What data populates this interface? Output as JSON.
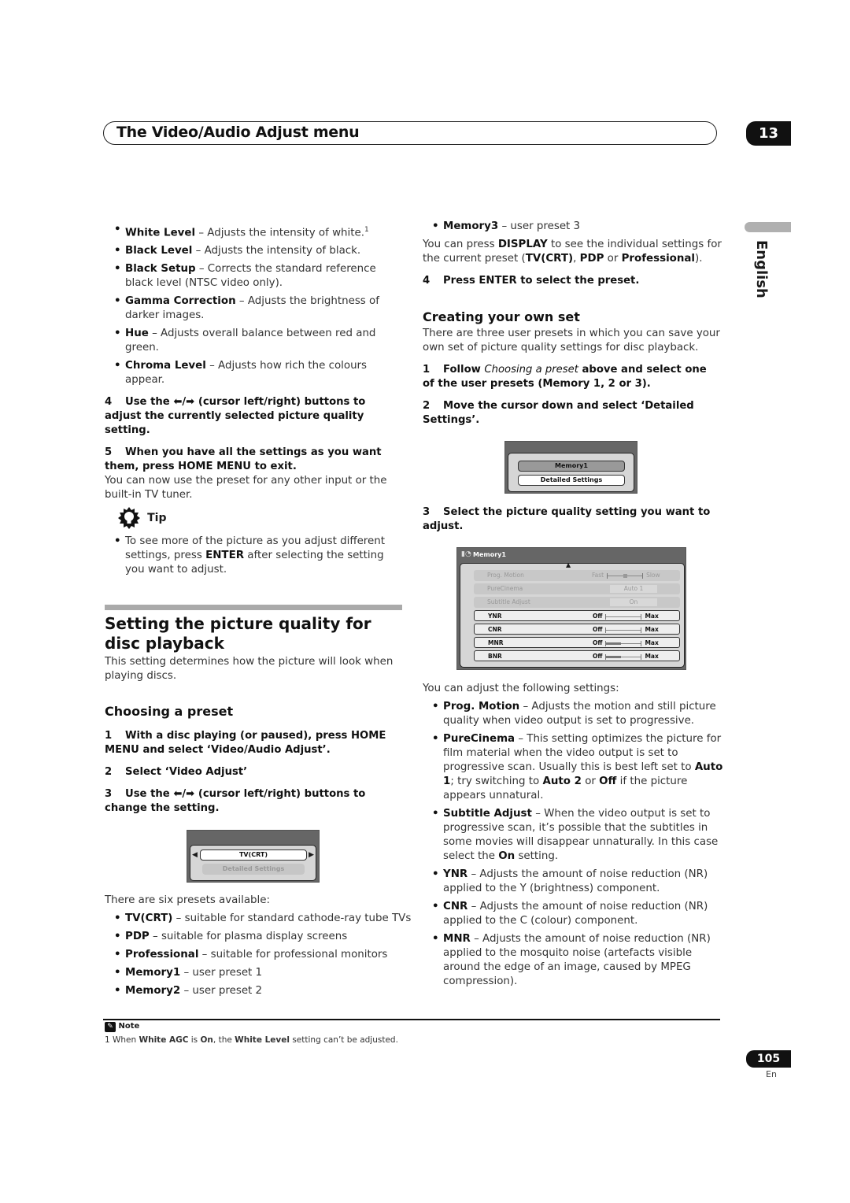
{
  "header": {
    "title": "The Video/Audio Adjust menu",
    "chapter": "13"
  },
  "language_tab": "English",
  "left_column": {
    "bullets_top": [
      {
        "term": "White Level",
        "desc": " – Adjusts the intensity of white.",
        "sup": "1"
      },
      {
        "term": "Black Level",
        "desc": " – Adjusts the intensity of black."
      },
      {
        "term": "Black Setup",
        "desc": " – Corrects the standard reference black level (NTSC video only)."
      },
      {
        "term": "Gamma Correction",
        "desc": " – Adjusts the brightness of darker images."
      },
      {
        "term": "Hue",
        "desc": " – Adjusts overall balance between red and green."
      },
      {
        "term": "Chroma Level",
        "desc": " – Adjusts how rich the colours appear."
      }
    ],
    "step4": {
      "num": "4",
      "text": "Use the ⬅/➡ (cursor left/right) buttons to adjust the currently selected picture quality setting."
    },
    "step5": {
      "num": "5",
      "text": "When you have all the settings as you want them, press HOME MENU to exit."
    },
    "step5_body": "You can now use the preset for any other input or the built-in TV tuner.",
    "tip": {
      "label": "Tip",
      "pre": "To see more of the picture as you adjust different settings, press ",
      "bold": "ENTER",
      "post": " after selecting the setting you want to adjust."
    },
    "section_title": "Setting the picture quality for disc playback",
    "section_intro": "This setting determines how the picture will look when playing discs.",
    "subsection": "Choosing a preset",
    "steps": [
      {
        "num": "1",
        "text": "With a disc playing (or paused), press HOME MENU and select ‘Video/Audio Adjust’."
      },
      {
        "num": "2",
        "text": "Select ‘Video Adjust’"
      },
      {
        "num": "3",
        "text": "Use the ⬅/➡ (cursor left/right) buttons to change the setting."
      }
    ],
    "screen1": {
      "selected": "TV(CRT)",
      "second": "Detailed Settings"
    },
    "presets_intro": "There are six presets available:",
    "presets": [
      {
        "term": "TV(CRT)",
        "desc": " – suitable for standard cathode-ray tube TVs"
      },
      {
        "term": "PDP",
        "desc": " – suitable for plasma display screens"
      },
      {
        "term": "Professional",
        "desc": " – suitable for professional monitors"
      },
      {
        "term": "Memory1",
        "desc": " – user preset 1"
      },
      {
        "term": "Memory2",
        "desc": " – user preset 2"
      }
    ]
  },
  "right_column": {
    "memory3": {
      "term": "Memory3",
      "desc": " – user preset 3"
    },
    "display_note": {
      "a": "You can press ",
      "b1": "DISPLAY",
      "c": " to see the individual settings for the current preset (",
      "b2": "TV(CRT)",
      "d": ", ",
      "b3": "PDP",
      "e": " or ",
      "b4": "Professional",
      "f": ")."
    },
    "step4": {
      "num": "4",
      "text": "Press ENTER to select the preset."
    },
    "subsection": "Creating your own set",
    "intro": "There are three user presets in which you can save your own set of picture quality settings for disc playback.",
    "step1": {
      "num": "1",
      "a": "Follow ",
      "i": "Choosing a preset",
      "b": " above and select one of the user presets (Memory 1, 2 or 3)."
    },
    "step2": {
      "num": "2",
      "text": "Move the cursor down and select ‘Detailed Settings’."
    },
    "screen2": {
      "first": "Memory1",
      "second": "Detailed Settings"
    },
    "step3": {
      "num": "3",
      "text": "Select the picture quality setting you want to adjust."
    },
    "screen3": {
      "title": "Memory1",
      "rows": [
        {
          "label": "Prog. Motion",
          "left": "Fast",
          "right": "Slow",
          "type": "slider-center",
          "value": 0.5,
          "active": false
        },
        {
          "label": "PureCinema",
          "value_text": "Auto 1",
          "type": "box",
          "active": false
        },
        {
          "label": "Subtitle Adjust",
          "value_text": "On",
          "type": "box",
          "active": false
        },
        {
          "label": "YNR",
          "left": "Off",
          "right": "Max",
          "type": "slider",
          "value": 0.0,
          "active": true
        },
        {
          "label": "CNR",
          "left": "Off",
          "right": "Max",
          "type": "slider",
          "value": 0.0,
          "active": true
        },
        {
          "label": "MNR",
          "left": "Off",
          "right": "Max",
          "type": "slider",
          "value": 0.43,
          "active": true
        },
        {
          "label": "BNR",
          "left": "Off",
          "right": "Max",
          "type": "slider",
          "value": 0.43,
          "active": true
        }
      ]
    },
    "adjust_intro": "You can adjust the following settings:",
    "settings": [
      {
        "term": "Prog. Motion",
        "desc": " – Adjusts the motion and still picture quality when video output is set to progressive."
      },
      {
        "term": "PureCinema",
        "desc": " – This setting optimizes the picture for film material when the video output is set to progressive scan. Usually this is best left set to ",
        "b1": "Auto 1",
        "d2": "; try switching to ",
        "b2": "Auto 2",
        "d3": " or ",
        "b3": "Off",
        "d4": " if the picture appears unnatural."
      },
      {
        "term": "Subtitle Adjust",
        "desc": " – When the video output is set to progressive scan, it’s possible that the subtitles in some movies will disappear unnaturally. In this case select the ",
        "b1": "On",
        "d2": " setting."
      },
      {
        "term": "YNR",
        "desc": " – Adjusts the amount of noise reduction (NR) applied to the Y (brightness) component."
      },
      {
        "term": "CNR",
        "desc": " – Adjusts the amount of noise reduction (NR) applied to the C (colour) component."
      },
      {
        "term": "MNR",
        "desc": " – Adjusts the amount of noise reduction (NR) applied to the mosquito noise (artefacts visible around the edge of an image, caused by MPEG compression)."
      }
    ]
  },
  "note": {
    "label": "Note",
    "num": "1",
    "a": " When ",
    "b1": "White AGC",
    "c": " is ",
    "b2": "On",
    "d": ", the ",
    "b3": "White Level",
    "e": " setting can’t be adjusted."
  },
  "footer": {
    "page": "105",
    "lang": "En"
  }
}
